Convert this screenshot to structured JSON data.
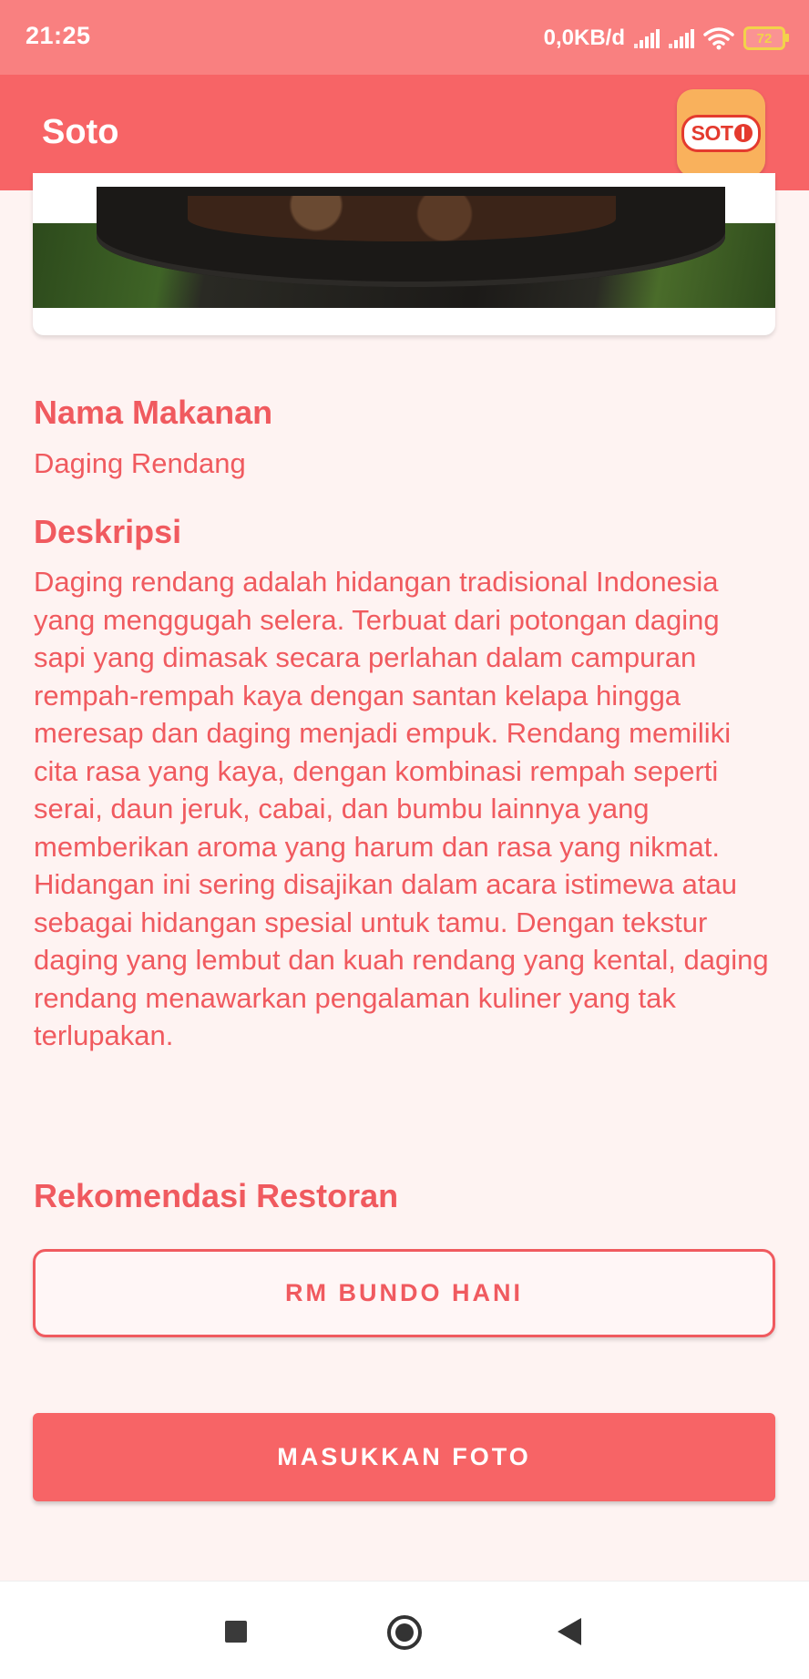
{
  "status_bar": {
    "time": "21:25",
    "network_speed": "0,0KB/d",
    "battery": "72"
  },
  "app_bar": {
    "title": "Soto",
    "logo_text": "SOT"
  },
  "food": {
    "name_label": "Nama Makanan",
    "name_value": "Daging Rendang",
    "description_label": "Deskripsi",
    "description_value": "Daging rendang adalah hidangan tradisional Indonesia yang menggugah selera. Terbuat dari potongan daging sapi yang dimasak secara perlahan dalam campuran rempah-rempah kaya dengan santan kelapa hingga meresap dan daging menjadi empuk. Rendang memiliki cita rasa yang kaya, dengan kombinasi rempah seperti serai, daun jeruk, cabai, dan bumbu lainnya yang memberikan aroma yang harum dan rasa yang nikmat. Hidangan ini sering disajikan dalam acara istimewa atau sebagai hidangan spesial untuk tamu. Dengan tekstur daging yang lembut dan kuah rendang yang kental, daging rendang menawarkan pengalaman kuliner yang tak terlupakan.",
    "recommendation_label": "Rekomendasi Restoran",
    "restaurant_button": "RM BUNDO HANI",
    "photo_button": "MASUKKAN FOTO"
  },
  "colors": {
    "status_bar": "#F98080",
    "app_bar": "#F76466",
    "accent_text": "#F05A5F",
    "background": "#FEF3F2"
  },
  "icons": [
    "signal-icon",
    "wifi-icon",
    "battery-icon",
    "soto-logo-icon",
    "recents-icon",
    "home-icon",
    "back-icon"
  ]
}
